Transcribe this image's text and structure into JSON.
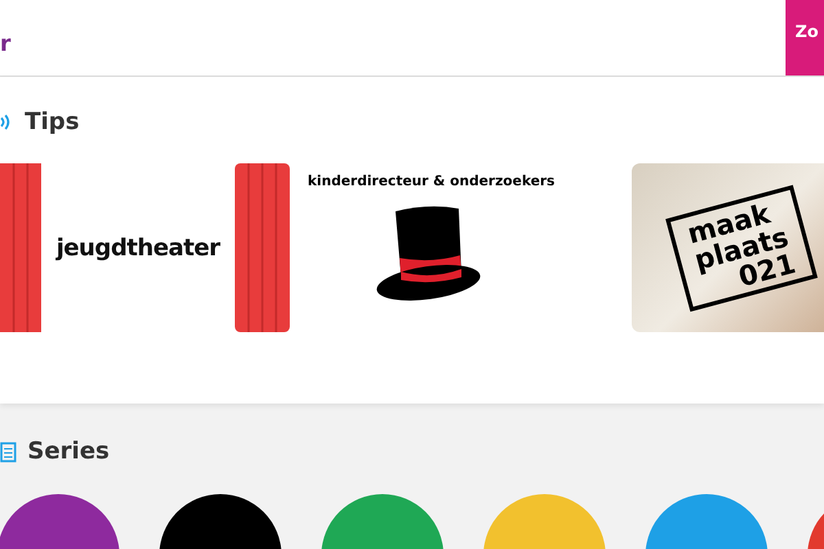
{
  "header": {
    "title_fragment": "r",
    "search_button": "Zo"
  },
  "tips": {
    "title": "Tips",
    "tiles": [
      {
        "kind": "theater",
        "text": "jeugdtheater"
      },
      {
        "kind": "hat",
        "text": "kinderdirecteur & onderzoekers"
      },
      {
        "kind": "maker",
        "lines": [
          "maak",
          "plaats",
          "021"
        ]
      }
    ]
  },
  "series": {
    "title": "Series",
    "covers": [
      {
        "color": "#8e2a9e"
      },
      {
        "color": "#000000"
      },
      {
        "color": "#1fa855"
      },
      {
        "color": "#f2c12e"
      },
      {
        "color": "#1ea0e6"
      },
      {
        "color": "#e23a2e"
      }
    ]
  }
}
